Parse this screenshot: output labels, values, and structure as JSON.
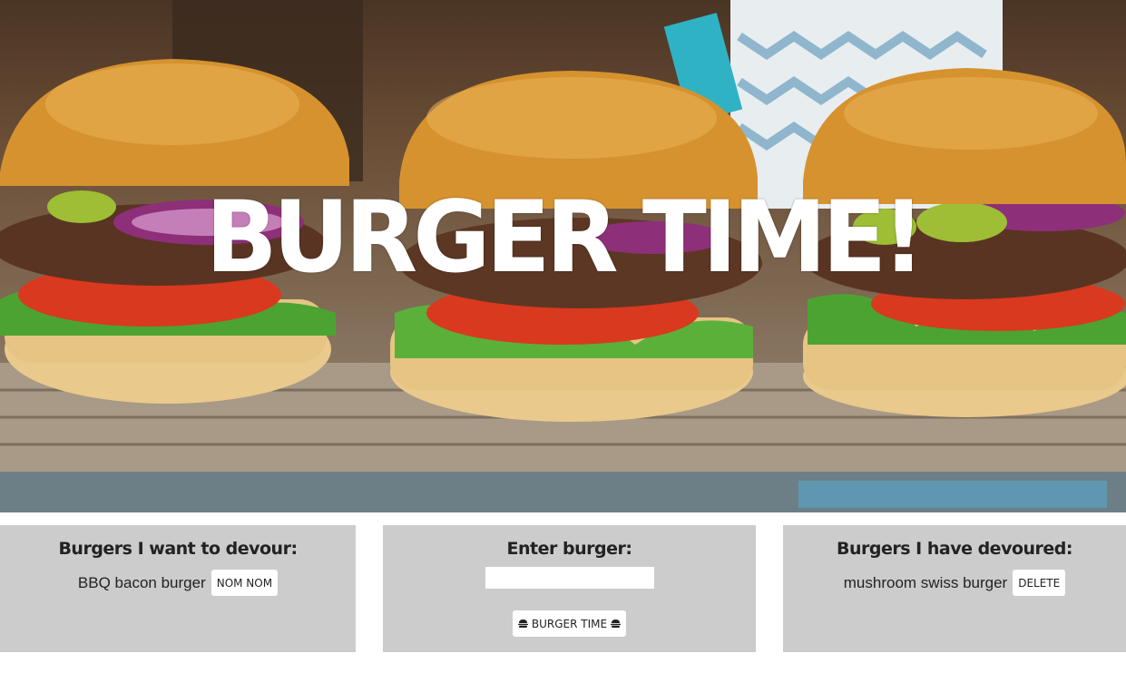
{
  "hero": {
    "title": "BURGER TIME!"
  },
  "want_panel": {
    "heading": "Burgers I want to devour:",
    "items": [
      {
        "name": "BBQ bacon burger",
        "button_label": "NOM NOM"
      }
    ]
  },
  "enter_panel": {
    "heading": "Enter burger:",
    "input_value": "",
    "submit_label": "BURGER TIME"
  },
  "devoured_panel": {
    "heading": "Burgers I have devoured:",
    "items": [
      {
        "name": "mushroom swiss burger",
        "button_label": "DELETE"
      }
    ]
  },
  "colors": {
    "panel_bg": "#cccccc",
    "button_bg": "#ffffff",
    "title_color": "#ffffff"
  },
  "icons": [
    "hamburger-icon"
  ]
}
